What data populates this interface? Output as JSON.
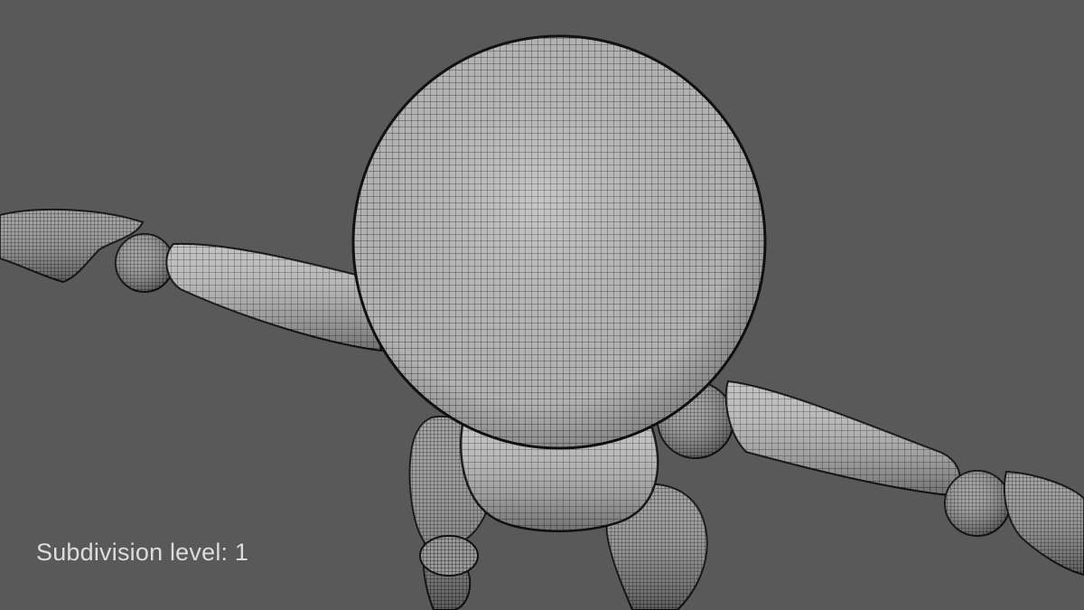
{
  "viewport": {
    "overlay_text": "Subdivision level: 1",
    "background_color": "#595959",
    "mesh_fill_color": "#bdbdbd",
    "wire_color": "#1e1e1e"
  }
}
